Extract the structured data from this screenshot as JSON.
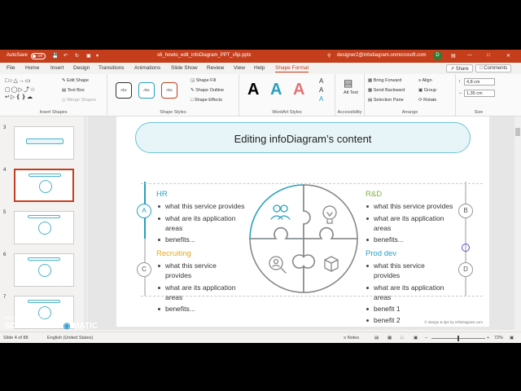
{
  "titlebar": {
    "autosave": "AutoSave",
    "toggle": "Off",
    "filename": "s6_howto_edit_infoDiagram_PPT_v5p.pptx",
    "account": "designer2@infodiagram.onmicrosoft.com",
    "avatar": "D"
  },
  "menu": {
    "items": [
      "File",
      "Home",
      "Insert",
      "Design",
      "Transitions",
      "Animations",
      "Slide Show",
      "Review",
      "View",
      "Help",
      "Shape Format"
    ],
    "active": "Shape Format",
    "share": "Share",
    "comments": "Comments"
  },
  "ribbon": {
    "insert_shapes": {
      "edit_shape": "Edit Shape",
      "text_box": "Text Box",
      "merge_shapes": "Merge Shapes",
      "label": "Insert Shapes"
    },
    "shape_styles": {
      "style_boxes": [
        "Abc",
        "Abc",
        "Abc"
      ],
      "fill": "Shape Fill",
      "outline": "Shape Outline",
      "effects": "Shape Effects",
      "label": "Shape Styles"
    },
    "wordart": {
      "letters": [
        "A",
        "A",
        "A"
      ],
      "label": "WordArt Styles"
    },
    "accessibility": {
      "alt_text": "Alt Text",
      "label": "Accessibility"
    },
    "arrange": {
      "bring_forward": "Bring Forward",
      "send_backward": "Send Backward",
      "selection_pane": "Selection Pane",
      "align": "Align",
      "group": "Group",
      "rotate": "Rotate",
      "label": "Arrange"
    },
    "size": {
      "height": "4,8 cm",
      "width": "1,35 cm",
      "label": "Size"
    }
  },
  "thumbnails": [
    {
      "num": "3"
    },
    {
      "num": "4"
    },
    {
      "num": "5"
    },
    {
      "num": "6"
    },
    {
      "num": "7"
    }
  ],
  "slide": {
    "title": "Editing infoDiagram’s content",
    "sections": [
      {
        "letter": "A",
        "heading": "HR",
        "items": [
          "what this service provides",
          "what are its application areas",
          "benefits..."
        ]
      },
      {
        "letter": "B",
        "heading": "R&D",
        "items": [
          "what this service provides",
          "what are its application areas",
          "benefits..."
        ]
      },
      {
        "letter": "C",
        "heading": "Recruiting",
        "items": [
          "what this service provides",
          "what are its application areas",
          "benefits..."
        ]
      },
      {
        "letter": "D",
        "heading": "Prod dev",
        "items": [
          "what this service provides",
          "what are its application areas",
          "benefit 1",
          "benefit 2"
        ]
      }
    ],
    "footer": "© design & tips by infoDiagram.com"
  },
  "status": {
    "slide_info": "Slide 4 of 88",
    "language": "English (United States)",
    "notes": "Notes",
    "zoom": "72%"
  },
  "watermark": {
    "line1": "RECORDED WITH",
    "line2": "SCREENCAST",
    "line3": "MATIC"
  },
  "colors": {
    "accent": "#c43e1c",
    "teal": "#2aa0c0",
    "hr": "#2aa0c0",
    "rd": "#7bb33a",
    "recruiting": "#e6a817",
    "proddev": "#2aa0c0"
  }
}
